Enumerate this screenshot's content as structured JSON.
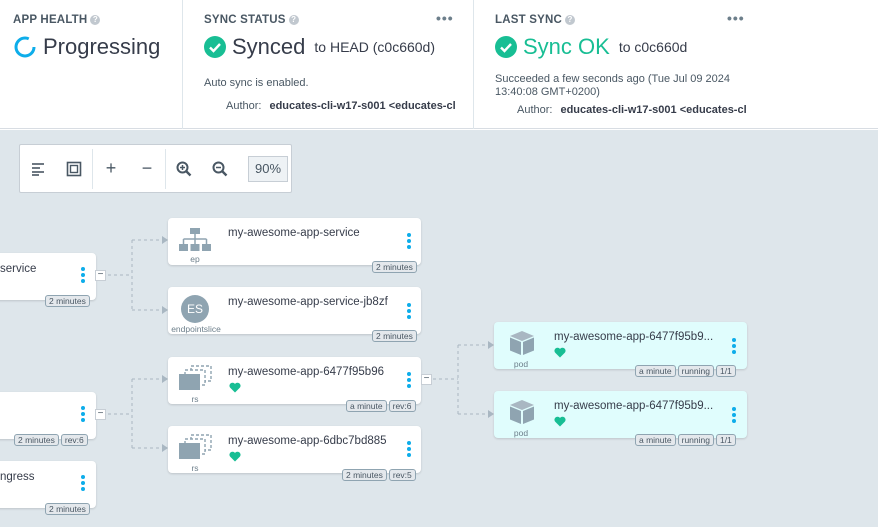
{
  "app_health": {
    "title": "APP HEALTH",
    "status": "Progressing",
    "status_color": "#0dadea"
  },
  "sync_status": {
    "title": "SYNC STATUS",
    "status": "Synced",
    "target": "to HEAD (c0c660d)",
    "auto_sync": "Auto sync is enabled.",
    "author_label": "Author:",
    "author_value": "educates-cli-w17-s001 <educates-cl",
    "status_color": "#18be94"
  },
  "last_sync": {
    "title": "LAST SYNC",
    "status": "Sync OK",
    "target": "to c0c660d",
    "detail_1": "Succeeded a few seconds ago (Tue Jul 09 2024",
    "detail_2": "13:40:08 GMT+0200)",
    "author_label": "Author:",
    "author_value": "educates-cli-w17-s001 <educates-cl",
    "status_color": "#18be94"
  },
  "menu_glyph": "•••",
  "toolbar": {
    "zoom": "90%",
    "plus": "+",
    "minus": "−"
  },
  "nodes": {
    "service": {
      "name": "service",
      "tags": [
        "2 minutes"
      ]
    },
    "deploy": {
      "name": "",
      "tags": [
        "2 minutes",
        "rev:6"
      ]
    },
    "ingress": {
      "name": "ngress",
      "tags": [
        "2 minutes"
      ]
    },
    "ep": {
      "name": "my-awesome-app-service",
      "kind": "ep",
      "tags": [
        "2 minutes"
      ]
    },
    "eps": {
      "name": "my-awesome-app-service-jb8zf",
      "kind": "endpointslice",
      "icon_text": "ES",
      "tags": [
        "2 minutes"
      ]
    },
    "rs1": {
      "name": "my-awesome-app-6477f95b96",
      "kind": "rs",
      "tags": [
        "a minute",
        "rev:6"
      ]
    },
    "rs2": {
      "name": "my-awesome-app-6dbc7bd885",
      "kind": "rs",
      "tags": [
        "2 minutes",
        "rev:5"
      ]
    },
    "pod1": {
      "name": "my-awesome-app-6477f95b9...",
      "kind": "pod",
      "tags": [
        "a minute",
        "running",
        "1/1"
      ]
    },
    "pod2": {
      "name": "my-awesome-app-6477f95b9...",
      "kind": "pod",
      "tags": [
        "a minute",
        "running",
        "1/1"
      ]
    }
  },
  "collapse_glyph": "−",
  "colors": {
    "healthy": "#18be94",
    "progressing": "#0dadea",
    "menu": "#0dadea",
    "graph_bg": "#dee6eb",
    "pod_bg": "#e0fdfd"
  }
}
